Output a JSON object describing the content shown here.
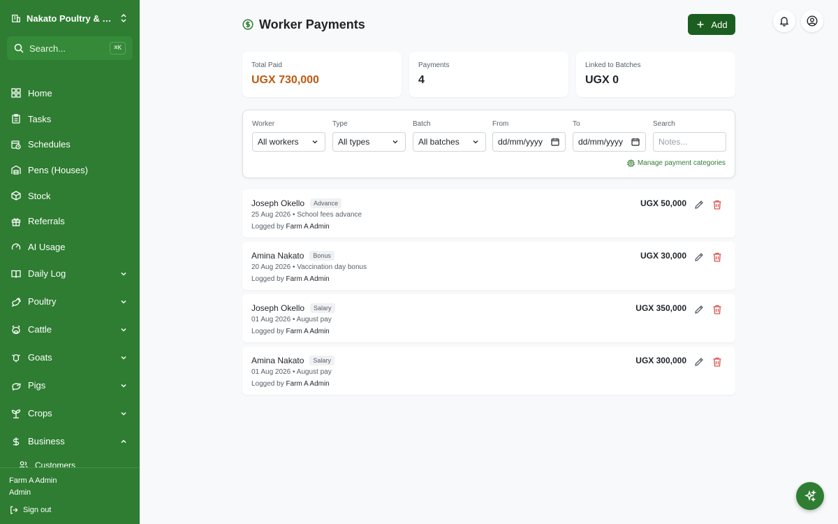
{
  "sidebar": {
    "farm_name": "Nakato Poultry & Da...",
    "search": {
      "placeholder": "Search...",
      "shortcut": "⌘K"
    },
    "items": [
      {
        "label": "Home",
        "icon": "grid-icon"
      },
      {
        "label": "Tasks",
        "icon": "clipboard-icon"
      },
      {
        "label": "Schedules",
        "icon": "calendar-clock-icon"
      },
      {
        "label": "Pens (Houses)",
        "icon": "warehouse-icon"
      },
      {
        "label": "Stock",
        "icon": "box-icon"
      },
      {
        "label": "Referrals",
        "icon": "gift-icon"
      },
      {
        "label": "AI Usage",
        "icon": "gauge-icon"
      }
    ],
    "groups": [
      {
        "label": "Daily Log",
        "icon": "book-icon",
        "expanded": false
      },
      {
        "label": "Poultry",
        "icon": "bird-icon",
        "expanded": false
      },
      {
        "label": "Cattle",
        "icon": "cattle-icon",
        "expanded": false
      },
      {
        "label": "Goats",
        "icon": "goat-icon",
        "expanded": false
      },
      {
        "label": "Pigs",
        "icon": "pig-icon",
        "expanded": false
      },
      {
        "label": "Crops",
        "icon": "sprout-icon",
        "expanded": false
      },
      {
        "label": "Business",
        "icon": "dollar-icon",
        "expanded": true
      }
    ],
    "sub_items": [
      {
        "label": "Customers",
        "icon": "users-icon"
      }
    ],
    "footer": {
      "user_name": "Farm A Admin",
      "role": "Admin",
      "sign_out": "Sign out"
    }
  },
  "header": {
    "title": "Worker Payments",
    "add_label": "Add"
  },
  "stats": [
    {
      "label": "Total Paid",
      "value": "UGX 730,000",
      "color": "#c0590e"
    },
    {
      "label": "Payments",
      "value": "4",
      "color": "#1f2328"
    },
    {
      "label": "Linked to Batches",
      "value": "UGX 0",
      "color": "#1f2328"
    }
  ],
  "filters": {
    "worker": {
      "label": "Worker",
      "value": "All workers"
    },
    "type": {
      "label": "Type",
      "value": "All types"
    },
    "batch": {
      "label": "Batch",
      "value": "All batches"
    },
    "from": {
      "label": "From",
      "value": "dd/mm/yyyy"
    },
    "to": {
      "label": "To",
      "value": "dd/mm/yyyy"
    },
    "search": {
      "label": "Search",
      "placeholder": "Notes..."
    },
    "manage_link": "Manage payment categories"
  },
  "payments": [
    {
      "worker": "Joseph Okello",
      "type": "Advance",
      "meta": "25 Aug 2026 • School fees advance",
      "logged_prefix": "Logged by",
      "logged_by": "Farm A Admin",
      "amount": "UGX 50,000"
    },
    {
      "worker": "Amina Nakato",
      "type": "Bonus",
      "meta": "20 Aug 2026 • Vaccination day bonus",
      "logged_prefix": "Logged by",
      "logged_by": "Farm A Admin",
      "amount": "UGX 30,000"
    },
    {
      "worker": "Joseph Okello",
      "type": "Salary",
      "meta": "01 Aug 2026 • August pay",
      "logged_prefix": "Logged by",
      "logged_by": "Farm A Admin",
      "amount": "UGX 350,000"
    },
    {
      "worker": "Amina Nakato",
      "type": "Salary",
      "meta": "01 Aug 2026 • August pay",
      "logged_prefix": "Logged by",
      "logged_by": "Farm A Admin",
      "amount": "UGX 300,000"
    }
  ],
  "colors": {
    "sidebar": "#2e7d32",
    "primary_button": "#1b5e20",
    "accent_amount": "#c0590e",
    "delete": "#d9534f"
  }
}
